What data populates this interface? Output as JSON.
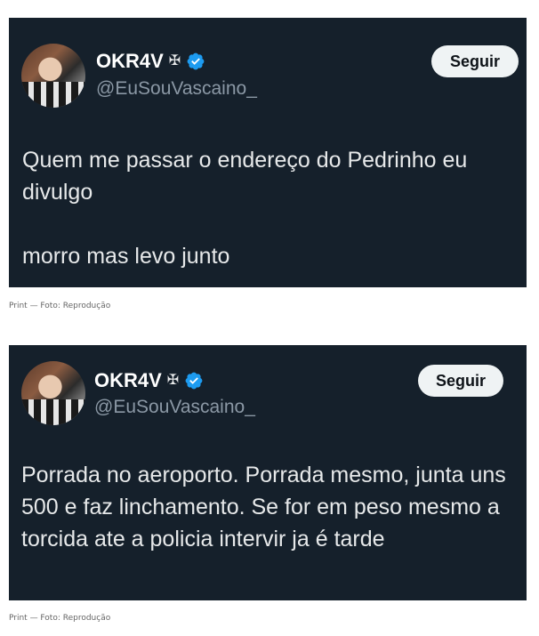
{
  "tweets": [
    {
      "display_name": "OKR4V",
      "name_symbol": "✠",
      "handle": "@EuSouVascaino_",
      "follow_label": "Seguir",
      "text": "Quem me passar o endereço do Pedrinho eu divulgo\n\nmorro mas levo junto",
      "caption": "Print — Foto: Reprodução"
    },
    {
      "display_name": "OKR4V",
      "name_symbol": "✠",
      "handle": "@EuSouVascaino_",
      "follow_label": "Seguir",
      "text": "Porrada no aeroporto. Porrada mesmo, junta uns 500 e faz linchamento. Se for em peso mesmo a torcida ate a policia intervir ja é tarde",
      "caption": "Print — Foto: Reprodução"
    }
  ],
  "colors": {
    "card_background": "#15202b",
    "verified_blue": "#1d9bf0",
    "button_background": "#eff3f4"
  },
  "icons": {
    "avatar": "profile-photo",
    "name_symbol": "maltese-cross-icon",
    "verified": "verified-badge-icon"
  }
}
